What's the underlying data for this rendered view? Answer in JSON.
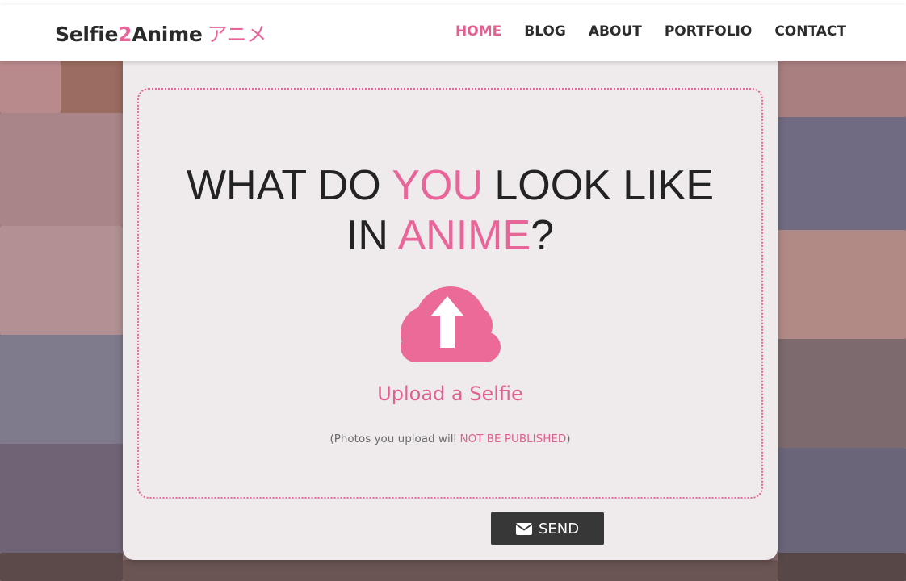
{
  "brand": {
    "name_start": "Selfie",
    "name_num": "2",
    "name_end": "Anime",
    "kana": "アニメ"
  },
  "nav": {
    "items": [
      {
        "label": "HOME",
        "active": true
      },
      {
        "label": "BLOG",
        "active": false
      },
      {
        "label": "ABOUT",
        "active": false
      },
      {
        "label": "PORTFOLIO",
        "active": false
      },
      {
        "label": "CONTACT",
        "active": false
      }
    ]
  },
  "hero": {
    "line1_a": "WHAT DO ",
    "line1_b": "YOU",
    "line1_c": " LOOK LIKE",
    "line2_a": "IN ",
    "line2_b": "ANIME",
    "line2_c": "?"
  },
  "upload": {
    "icon": "cloud-upload-icon",
    "label": "Upload a Selfie",
    "note_a": "(Photos you upload will ",
    "note_b": "NOT BE PUBLISHED",
    "note_c": ")"
  },
  "send_button": {
    "icon": "envelope-icon",
    "label": "SEND"
  },
  "colors": {
    "accent": "#e8659a",
    "dark": "#373737",
    "card": "#f4f1f2"
  }
}
